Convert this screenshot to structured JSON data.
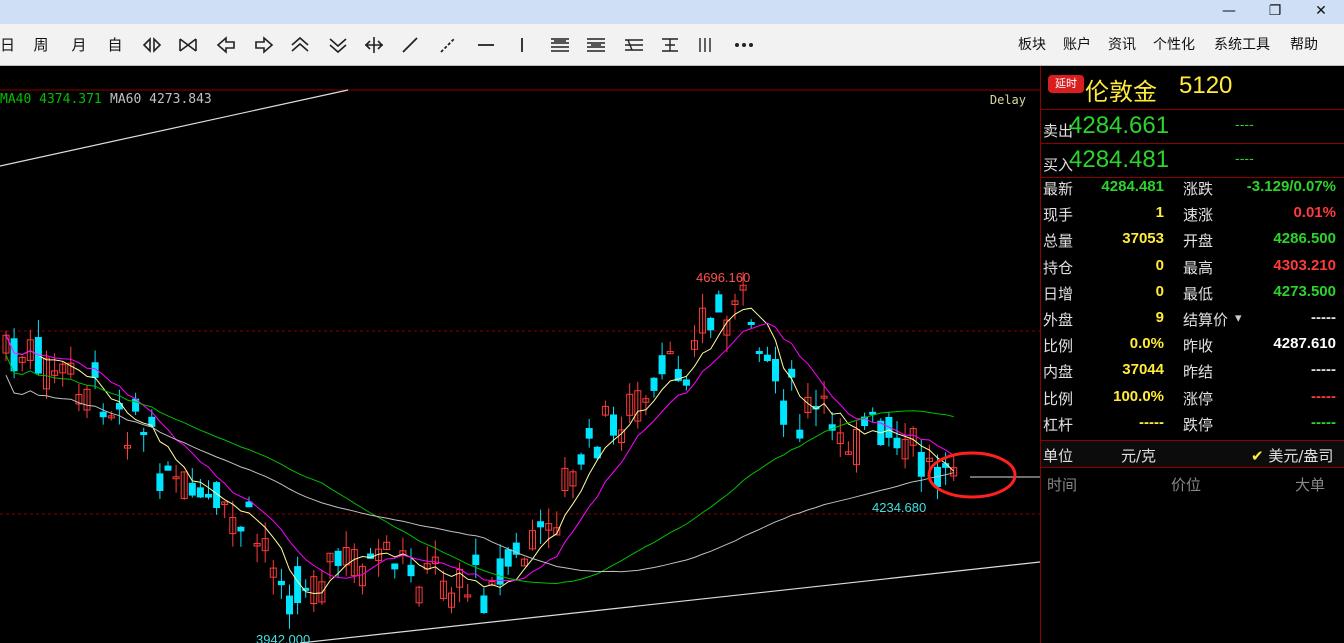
{
  "window": {
    "minimize": "—",
    "maximize": "❐",
    "close": "✕"
  },
  "toolbar": {
    "period_items": [
      "日",
      "周",
      "月",
      "自"
    ],
    "icons": [
      "zoom-in-icon",
      "zoom-out-icon",
      "scroll-left-icon",
      "scroll-right-icon",
      "expand-up-icon",
      "collapse-down-icon",
      "crosshair-icon",
      "line-draw-icon",
      "dotted-line-icon",
      "horizontal-line-icon",
      "vertical-line-icon",
      "indicator-a-icon",
      "indicator-b-icon",
      "indicator-c-icon",
      "indicator-d-icon",
      "parallel-lines-icon",
      "more-icon"
    ],
    "menu": [
      "板块",
      "账户",
      "资讯",
      "个性化",
      "系统工具",
      "帮助"
    ]
  },
  "chart": {
    "ma40_label": "MA40",
    "ma40_value": "4374.371",
    "ma60_label": "MA60",
    "ma60_value": "4273.843",
    "delay_label": "Delay",
    "high_annotation": "4696.160",
    "low_annotation": "4234.680",
    "bottom_annotation": "3942.000",
    "colors": {
      "up": "#ff3b3b",
      "down": "#00e5ff",
      "ma40": "#00c000",
      "ma60": "#c0c0c0",
      "ma10": "#ff00ff",
      "ma5": "#ffffa0",
      "highlight": "#ff2020"
    }
  },
  "chart_data": {
    "type": "candlestick",
    "series": [
      {
        "name": "MA40",
        "last_value": 4374.371
      },
      {
        "name": "MA60",
        "last_value": 4273.843
      }
    ],
    "annotations": [
      {
        "label": "4696.160",
        "value": 4696.16
      },
      {
        "label": "4234.680",
        "value": 4234.68
      },
      {
        "label": "3942.000",
        "value": 3942.0
      }
    ]
  },
  "panel": {
    "delay_badge": "延时",
    "instrument_name": "伦敦金",
    "instrument_code": "5120",
    "sell_label": "卖出",
    "sell_price": "4284.661",
    "sell_volume": "----",
    "buy_label": "买入",
    "buy_price": "4284.481",
    "buy_volume": "----",
    "stats_left": [
      {
        "label": "最新",
        "value": "4284.481",
        "color": "#2bd42b"
      },
      {
        "label": "现手",
        "value": "1",
        "color": "#ffeb3b"
      },
      {
        "label": "总量",
        "value": "37053",
        "color": "#ffeb3b"
      },
      {
        "label": "持仓",
        "value": "0",
        "color": "#ffeb3b"
      },
      {
        "label": "日增",
        "value": "0",
        "color": "#ffeb3b"
      },
      {
        "label": "外盘",
        "value": "9",
        "color": "#ffeb3b"
      },
      {
        "label": "比例",
        "value": "0.0%",
        "color": "#ffeb3b"
      },
      {
        "label": "内盘",
        "value": "37044",
        "color": "#ffeb3b"
      },
      {
        "label": "比例",
        "value": "100.0%",
        "color": "#ffeb3b"
      },
      {
        "label": "杠杆",
        "value": "-----",
        "color": "#ffeb3b"
      }
    ],
    "stats_right": [
      {
        "label": "涨跌",
        "value": "-3.129/0.07%",
        "color": "#2bd42b"
      },
      {
        "label": "速涨",
        "value": "0.01%",
        "color": "#ff3b3b"
      },
      {
        "label": "开盘",
        "value": "4286.500",
        "color": "#2bd42b"
      },
      {
        "label": "最高",
        "value": "4303.210",
        "color": "#ff3b3b"
      },
      {
        "label": "最低",
        "value": "4273.500",
        "color": "#2bd42b"
      },
      {
        "label": "结算价",
        "value": "-----",
        "color": "#e0e0e0"
      },
      {
        "label": "昨收",
        "value": "4287.610",
        "color": "#ffffff"
      },
      {
        "label": "昨结",
        "value": "-----",
        "color": "#e0e0e0"
      },
      {
        "label": "涨停",
        "value": "-----",
        "color": "#ff3b3b"
      },
      {
        "label": "跌停",
        "value": "-----",
        "color": "#2bd42b"
      }
    ],
    "unit_label": "单位",
    "unit_value": "元/克",
    "unit_alt": "美元/盎司",
    "tick_headers": [
      "时间",
      "价位",
      "大单"
    ]
  }
}
